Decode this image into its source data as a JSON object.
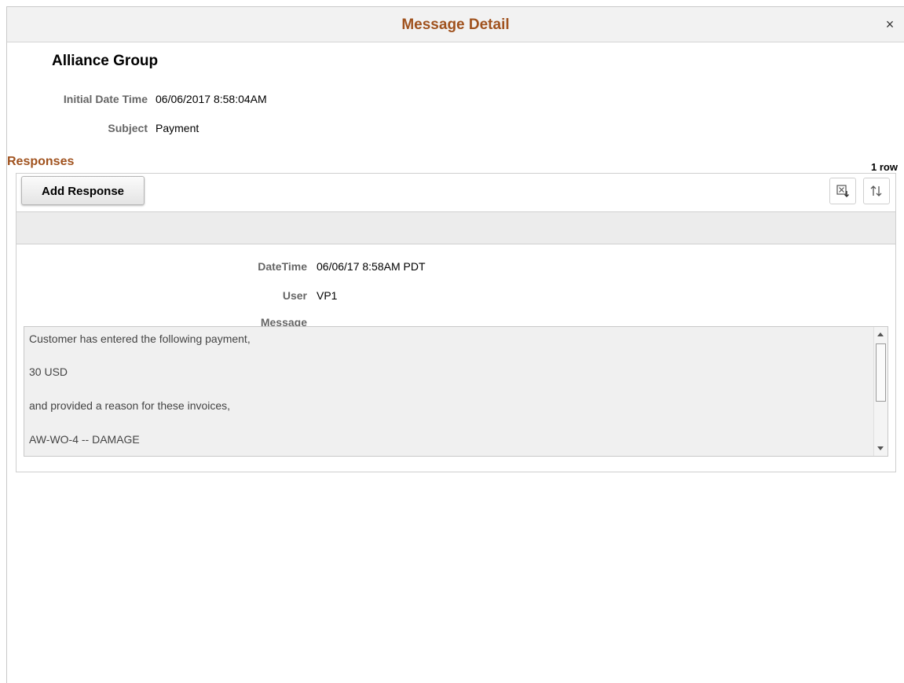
{
  "dialog": {
    "title": "Message Detail",
    "close_label": "×"
  },
  "header": {
    "group_name": "Alliance Group",
    "initial_date_time_label": "Initial Date Time",
    "initial_date_time_value": "06/06/2017  8:58:04AM",
    "subject_label": "Subject",
    "subject_value": "Payment"
  },
  "responses": {
    "title": "Responses",
    "row_count": "1 row",
    "add_button_label": "Add Response",
    "icons": {
      "download": "excel-download-icon",
      "sort": "sort-icon"
    },
    "rows": [
      {
        "datetime_label": "DateTime",
        "datetime_value": "06/06/17  8:58AM PDT",
        "user_label": "User",
        "user_value": "VP1",
        "message_label": "Message",
        "message_lines": [
          "Customer has entered the following payment,",
          "30  USD",
          "and provided a reason for these invoices,",
          "AW-WO-4 -- DAMAGE"
        ]
      }
    ]
  },
  "colors": {
    "accent": "#a0521e",
    "label_gray": "#666666"
  }
}
